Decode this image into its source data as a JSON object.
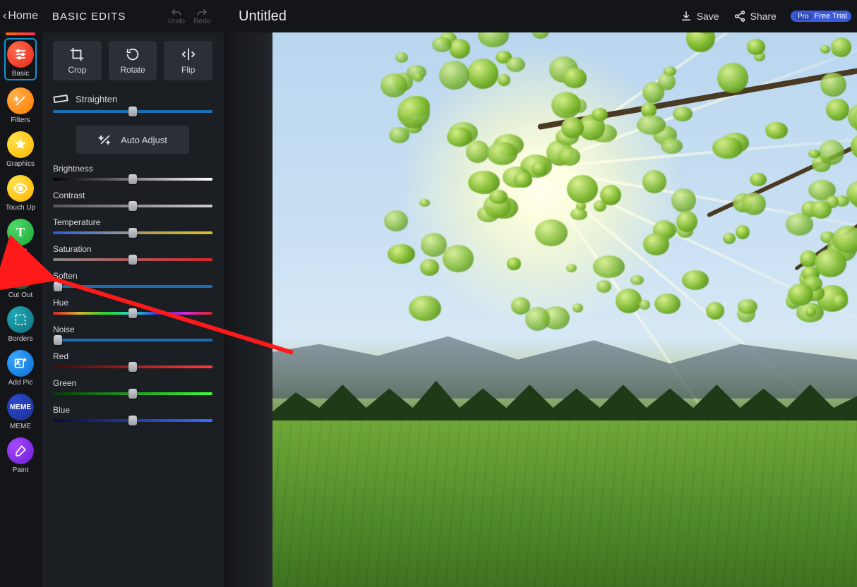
{
  "header": {
    "home": "Home",
    "panel_title": "BASIC EDITS",
    "undo": "Undo",
    "redo": "Redo",
    "doc_title": "Untitled",
    "save": "Save",
    "share": "Share",
    "pro_badge": "Pro",
    "pro_trial": "Free Trial"
  },
  "rail": {
    "items": [
      {
        "key": "basic",
        "label": "Basic"
      },
      {
        "key": "filters",
        "label": "Filters"
      },
      {
        "key": "graphics",
        "label": "Graphics"
      },
      {
        "key": "touchup",
        "label": "Touch Up"
      },
      {
        "key": "text",
        "label": "Text"
      },
      {
        "key": "cutout",
        "label": "Cut Out"
      },
      {
        "key": "borders",
        "label": "Borders"
      },
      {
        "key": "addpic",
        "label": "Add Pic"
      },
      {
        "key": "meme",
        "label": "MEME"
      },
      {
        "key": "paint",
        "label": "Paint"
      }
    ]
  },
  "tiles": {
    "crop": "Crop",
    "rotate": "Rotate",
    "flip": "Flip"
  },
  "buttons": {
    "straighten": "Straighten",
    "auto_adjust": "Auto Adjust"
  },
  "sliders": [
    {
      "key": "brightness",
      "label": "Brightness",
      "pos": 50,
      "gradient": "g-bw"
    },
    {
      "key": "contrast",
      "label": "Contrast",
      "pos": 50,
      "gradient": "g-gray"
    },
    {
      "key": "temperature",
      "label": "Temperature",
      "pos": 50,
      "gradient": "g-temp"
    },
    {
      "key": "saturation",
      "label": "Saturation",
      "pos": 50,
      "gradient": "g-sat"
    },
    {
      "key": "soften",
      "label": "Soften",
      "pos": 3,
      "gradient": "g-blue"
    },
    {
      "key": "hue",
      "label": "Hue",
      "pos": 50,
      "gradient": "g-hue"
    },
    {
      "key": "noise",
      "label": "Noise",
      "pos": 3,
      "gradient": "g-blue"
    },
    {
      "key": "red",
      "label": "Red",
      "pos": 50,
      "gradient": "g-red"
    },
    {
      "key": "green",
      "label": "Green",
      "pos": 50,
      "gradient": "g-green"
    },
    {
      "key": "blue",
      "label": "Blue",
      "pos": 50,
      "gradient": "g-bluec"
    }
  ],
  "straighten_slider": {
    "pos": 50,
    "gradient": "g-blue"
  },
  "meme_text": "MEME",
  "text_glyph": "T"
}
